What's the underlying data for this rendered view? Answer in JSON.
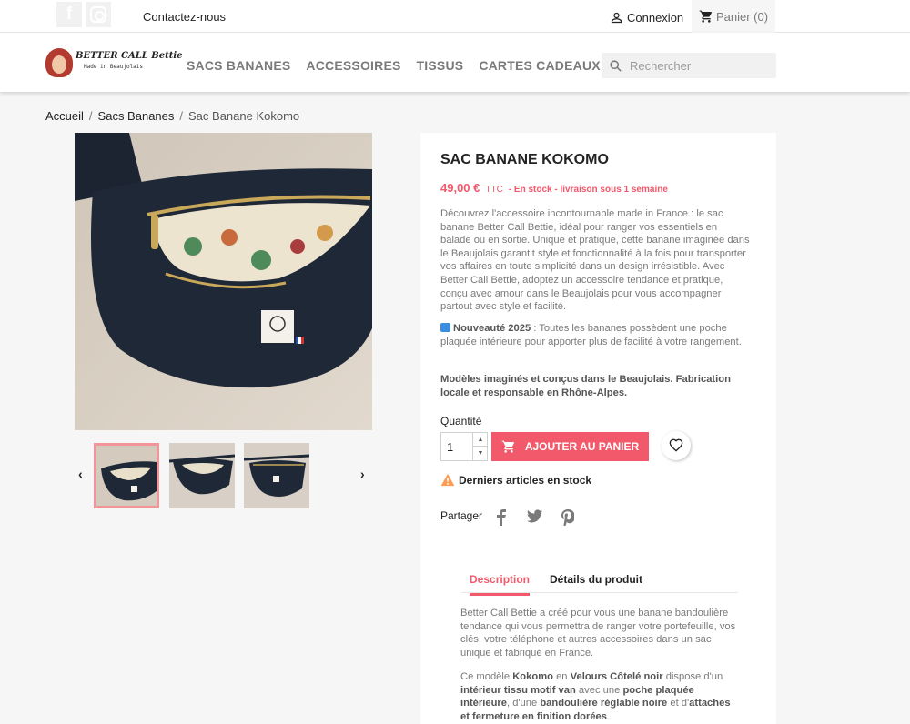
{
  "topbar": {
    "contact": "Contactez-nous",
    "login": "Connexion",
    "cart": "Panier (0)"
  },
  "header": {
    "logo_text": "BETTER CALL Bettie",
    "logo_sub": "Made in Beaujolais",
    "nav": [
      "SACS BANANES",
      "ACCESSOIRES",
      "TISSUS",
      "CARTES CADEAUX"
    ],
    "search_placeholder": "Rechercher"
  },
  "breadcrumb": [
    "Accueil",
    "Sacs Bananes",
    "Sac Banane Kokomo"
  ],
  "product": {
    "title": "SAC BANANE KOKOMO",
    "price": "49,00 €",
    "tax": "TTC",
    "availability": "- En stock - livraison sous 1 semaine",
    "description": "Découvrez l'accessoire incontournable made in France : le sac banane Better Call Bettie, idéal pour ranger vos essentiels en balade ou en sortie. Unique et pratique, cette banane imaginée dans le Beaujolais garantit style et fonctionnalité à la fois pour transporter vos affaires en toute simplicité dans un design irrésistible. Avec Better Call Bettie, adoptez un accessoire tendance et pratique, conçu avec amour dans le Beaujolais pour vous accompagner partout avec style et facilité.",
    "new_label": "Nouveauté 2025",
    "new_text": " : Toutes les bananes possèdent une poche plaquée intérieure pour apporter plus de facilité à votre rangement.",
    "local": "Modèles imaginés et conçus dans le Beaujolais. Fabrication locale et responsable en Rhône-Alpes.",
    "quantity_label": "Quantité",
    "quantity_value": "1",
    "add_to_cart": "AJOUTER AU PANIER",
    "stock_warning": "Derniers articles en stock",
    "share_label": "Partager"
  },
  "tabs": {
    "items": [
      "Description",
      "Détails du produit"
    ],
    "active": 0,
    "body1": "Better Call Bettie a créé pour vous une banane bandoulière tendance qui vous permettra de ranger votre portefeuille, vos clés, votre téléphone et autres accessoires dans un sac unique et fabriqué en France.",
    "body2_parts": [
      "Ce modèle ",
      "Kokomo",
      " en ",
      "Velours Côtelé noir",
      " dispose d'un ",
      "intérieur tissu motif van",
      " avec une ",
      "poche plaquée intérieure",
      ", d'une ",
      "bandoulière réglable noire",
      " et d'",
      "attaches et fermeture en finition dorées",
      "."
    ]
  },
  "colors": {
    "accent": "#f2596b",
    "text": "#232323",
    "muted": "#7a7a7a",
    "background": "#f6f6f6"
  },
  "icons": [
    "facebook-icon",
    "instagram-icon",
    "user-icon",
    "cart-icon",
    "search-icon",
    "chevron-left-icon",
    "chevron-right-icon",
    "cart-add-icon",
    "heart-icon",
    "warning-icon",
    "facebook-share-icon",
    "twitter-share-icon",
    "pinterest-share-icon",
    "new-badge-icon"
  ]
}
